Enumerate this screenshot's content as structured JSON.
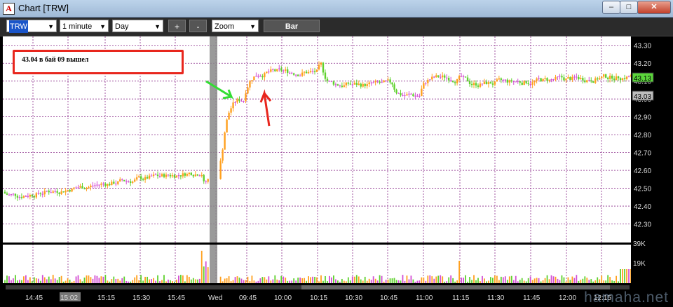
{
  "window": {
    "title": "Chart [TRW]",
    "app_icon": "A",
    "min_label": "–",
    "max_label": "□",
    "close_label": "✕"
  },
  "toolbar": {
    "symbol": "TRW",
    "interval": "1 minute",
    "period": "Day",
    "zoom_in": "+",
    "zoom_out": "-",
    "zoom": "Zoom",
    "bar": "Bar"
  },
  "annotation": {
    "text": "43.04 в бай 09 вышел",
    "border_color": "#e8261d"
  },
  "price_axis": [
    "43.30",
    "43.20",
    "43.10",
    "43.00",
    "42.90",
    "42.80",
    "42.70",
    "42.60",
    "42.50",
    "42.40",
    "42.30"
  ],
  "price_markers": {
    "last": "43.13",
    "last_color": "#5bd63b",
    "bid": "43.03"
  },
  "volume_axis": [
    "39K",
    "19K"
  ],
  "time_axis": [
    "14:45",
    "15:02",
    "15:15",
    "15:30",
    "15:45",
    "Wed",
    "09:45",
    "10:00",
    "10:15",
    "10:30",
    "10:45",
    "11:00",
    "11:15",
    "11:30",
    "11:45",
    "12:00",
    "12:15"
  ],
  "watermark": "hamaha.net",
  "colors": {
    "up": "#ffa01e",
    "down": "#5fd12e",
    "flat": "#d34fd3",
    "grid": "#8a2c8a",
    "separator": "#888888"
  },
  "chart_data": {
    "type": "candlestick",
    "symbol": "TRW",
    "ylim": [
      42.2,
      43.35
    ],
    "events": {
      "entry_price": 43.04,
      "session_break": "Wed"
    },
    "series_summary": {
      "prev_session_range": [
        42.45,
        42.62
      ],
      "gap_open": 42.7,
      "session_high": 43.24,
      "last": 43.13
    }
  }
}
